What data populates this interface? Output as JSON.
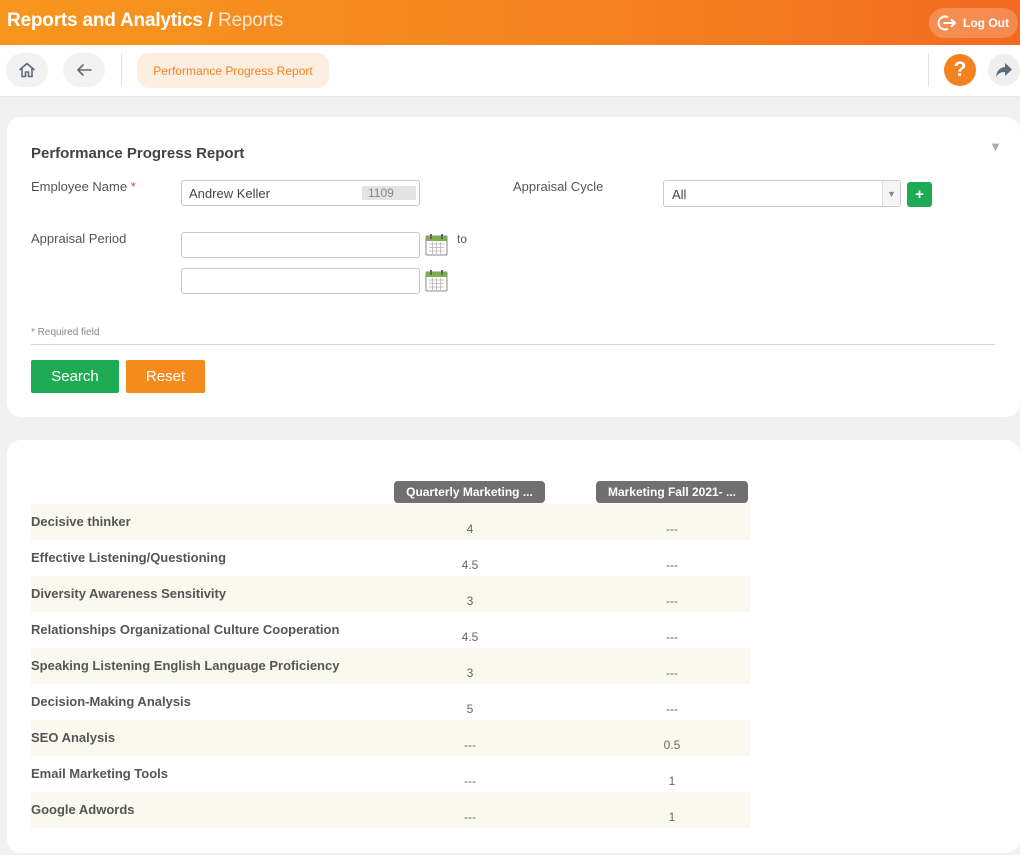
{
  "header": {
    "title": "Reports and Analytics",
    "separator": "/",
    "crumb": "Reports",
    "logout_label": "Log Out"
  },
  "toolbar": {
    "breadcrumb_pill": "Performance Progress Report",
    "help_label": "?"
  },
  "form": {
    "title": "Performance Progress Report",
    "employee_label": "Employee Name",
    "required_mark": "*",
    "employee_value": "Andrew Keller",
    "employee_id": "1109",
    "cycle_label": "Appraisal Cycle",
    "cycle_value": "All",
    "add_label": "+",
    "period_label": "Appraisal Period",
    "to_label": "to",
    "date_from": "",
    "date_to": "",
    "required_note": "* Required field",
    "search_label": "Search",
    "reset_label": "Reset"
  },
  "results": {
    "columns": [
      "Quarterly Marketing ...",
      "Marketing Fall 2021- ..."
    ],
    "rows": [
      {
        "criterion": "Decisive thinker",
        "values": [
          "4",
          "---"
        ]
      },
      {
        "criterion": "Effective Listening/Questioning",
        "values": [
          "4.5",
          "---"
        ]
      },
      {
        "criterion": "Diversity Awareness Sensitivity",
        "values": [
          "3",
          "---"
        ]
      },
      {
        "criterion": "Relationships Organizational Culture Cooperation",
        "values": [
          "4.5",
          "---"
        ]
      },
      {
        "criterion": "Speaking Listening English Language Proficiency",
        "values": [
          "3",
          "---"
        ]
      },
      {
        "criterion": "Decision-Making Analysis",
        "values": [
          "5",
          "---"
        ]
      },
      {
        "criterion": "SEO Analysis",
        "values": [
          "---",
          "0.5"
        ]
      },
      {
        "criterion": "Email Marketing Tools",
        "values": [
          "---",
          "1"
        ]
      },
      {
        "criterion": "Google Adwords",
        "values": [
          "---",
          "1"
        ]
      }
    ]
  },
  "colors": {
    "accent": "#f58220",
    "success": "#1fab54",
    "column_header": "#707070",
    "row_alt": "#faf9f0"
  }
}
